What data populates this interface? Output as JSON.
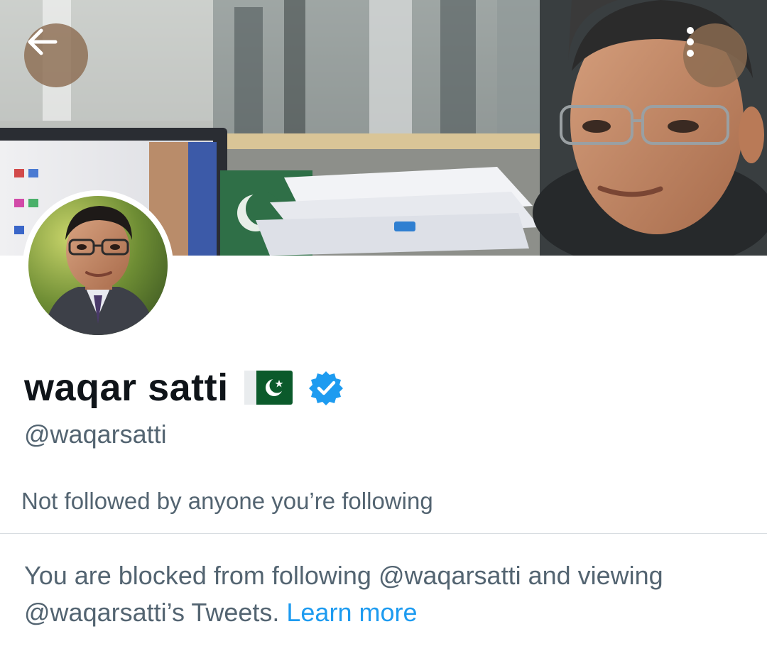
{
  "header": {
    "back_icon": "arrow-left-icon",
    "more_icon": "vertical-dots-icon"
  },
  "profile": {
    "display_name": "waqar satti",
    "flag_icon": "pakistan-flag-icon",
    "verified_icon": "verified-badge-icon",
    "verified_color": "#1d9bf0",
    "handle": "@waqarsatti",
    "followed_by_text": "Not followed by anyone you’re following"
  },
  "blocked_notice": {
    "text": "You are blocked from following @waqarsatti and viewing @waqarsatti’s Tweets.",
    "link_label": "Learn more",
    "link_color": "#1d9bf0"
  }
}
